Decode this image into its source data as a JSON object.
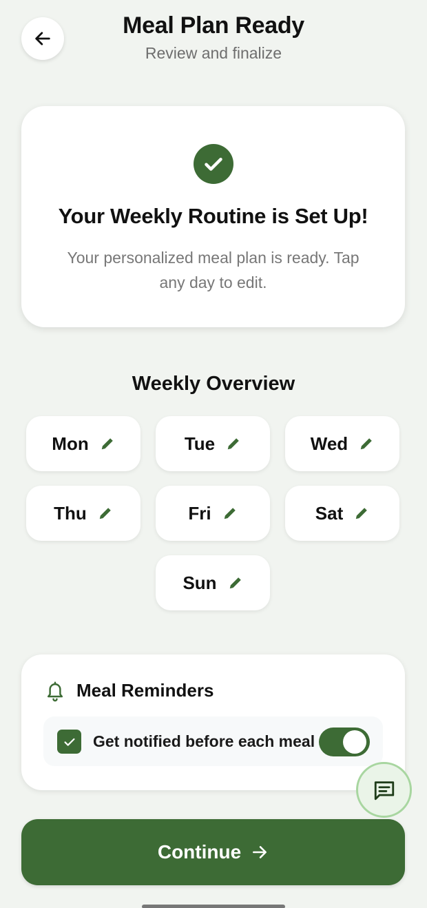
{
  "header": {
    "title": "Meal Plan Ready",
    "subtitle": "Review and finalize"
  },
  "success_card": {
    "title": "Your Weekly Routine is Set Up!",
    "description": "Your personalized meal plan is ready. Tap any day to edit."
  },
  "overview": {
    "title": "Weekly Overview",
    "days": [
      "Mon",
      "Tue",
      "Wed",
      "Thu",
      "Fri",
      "Sat",
      "Sun"
    ]
  },
  "reminders": {
    "title": "Meal Reminders",
    "option_label": "Get notified before each meal",
    "checked": true,
    "toggle_on": true
  },
  "continue": {
    "label": "Continue"
  },
  "icons": {
    "back": "arrow-left-icon",
    "success": "check-circle-icon",
    "edit": "pencil-icon",
    "bell": "bell-icon",
    "chat": "chat-icon",
    "continue": "arrow-right-icon"
  },
  "colors": {
    "accent": "#3d6b35",
    "background": "#f1f4f0",
    "chat_fab_border": "#a8d6a0"
  }
}
